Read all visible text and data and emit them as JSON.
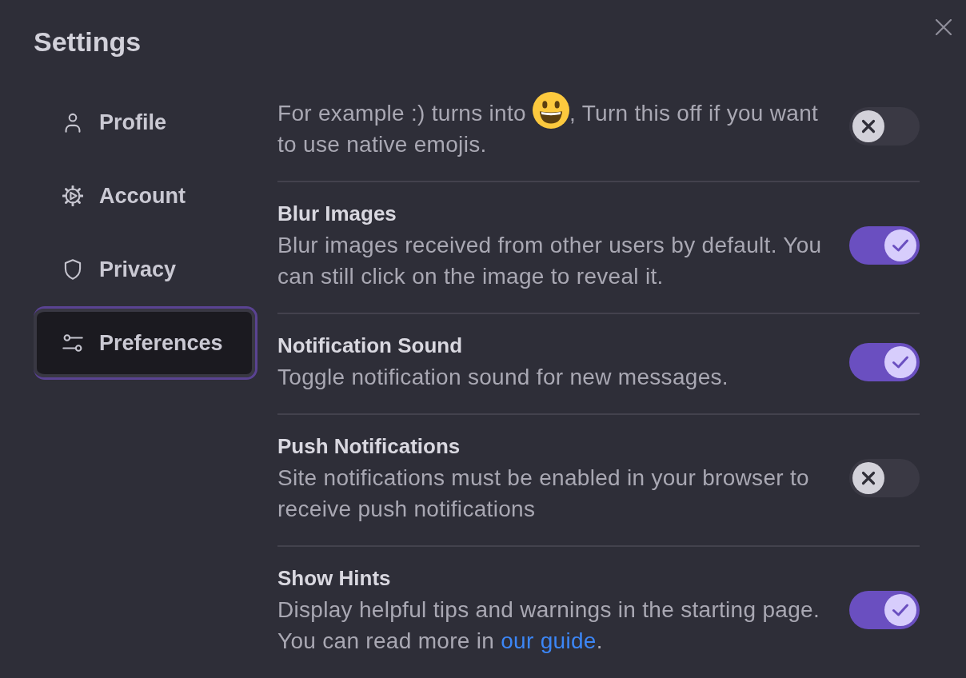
{
  "title": "Settings",
  "sidebar": {
    "items": [
      {
        "label": "Profile",
        "selected": false
      },
      {
        "label": "Account",
        "selected": false
      },
      {
        "label": "Privacy",
        "selected": false
      },
      {
        "label": "Preferences",
        "selected": true
      }
    ]
  },
  "settings": [
    {
      "kind": "emoji",
      "description_before_emoji": "For example :) turns into",
      "description_after_emoji": ", Turn this off if you want to use native emojis.",
      "on": false
    },
    {
      "kind": "plain",
      "title": "Blur Images",
      "description": "Blur images received from other users by default. You can still click on the image to reveal it.",
      "on": true
    },
    {
      "kind": "plain",
      "title": "Notification Sound",
      "description": "Toggle notification sound for new messages.",
      "on": true
    },
    {
      "kind": "plain",
      "title": "Push Notifications",
      "description": "Site notifications must be enabled in your browser to receive push notifications",
      "on": false
    },
    {
      "kind": "link",
      "title": "Show Hints",
      "description": "Display helpful tips and warnings in the starting page. You can read more in",
      "link": "our guide",
      "description_end": ".",
      "on": true
    }
  ]
}
